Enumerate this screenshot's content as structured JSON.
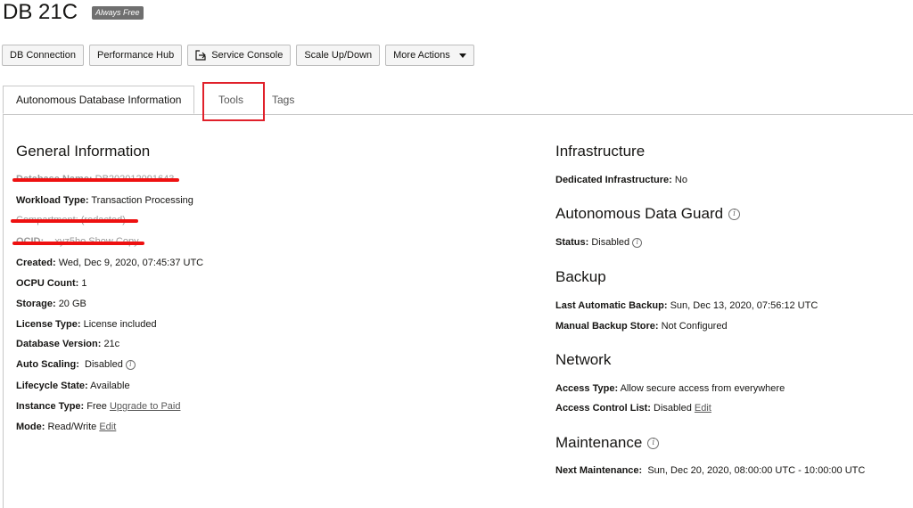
{
  "header": {
    "title": "DB 21C",
    "badge": "Always Free"
  },
  "toolbar": {
    "db_connection": "DB Connection",
    "performance_hub": "Performance Hub",
    "service_console": "Service Console",
    "scale": "Scale Up/Down",
    "more_actions": "More Actions"
  },
  "tabs": {
    "info": "Autonomous Database Information",
    "tools": "Tools",
    "tags": "Tags"
  },
  "general": {
    "heading": "General Information",
    "db_name_label": "Database Name:",
    "db_name_value": "DB202012091643",
    "workload_label": "Workload Type:",
    "workload_value": "Transaction Processing",
    "compartment_text": "Compartment: (redacted)",
    "ocid_label": "OCID:",
    "ocid_value": "...xyz5ho Show Copy",
    "created_label": "Created:",
    "created_value": "Wed, Dec 9, 2020, 07:45:37 UTC",
    "ocpu_label": "OCPU Count:",
    "ocpu_value": "1",
    "storage_label": "Storage:",
    "storage_value": "20 GB",
    "license_label": "License Type:",
    "license_value": "License included",
    "version_label": "Database Version:",
    "version_value": "21c",
    "autoscale_label": "Auto Scaling:",
    "autoscale_value": "Disabled",
    "lifecycle_label": "Lifecycle State:",
    "lifecycle_value": "Available",
    "instance_label": "Instance Type:",
    "instance_value": "Free",
    "upgrade_link": "Upgrade to Paid",
    "mode_label": "Mode:",
    "mode_value": "Read/Write",
    "mode_edit": "Edit"
  },
  "infrastructure": {
    "heading": "Infrastructure",
    "dedicated_label": "Dedicated Infrastructure:",
    "dedicated_value": "No"
  },
  "data_guard": {
    "heading": "Autonomous Data Guard",
    "status_label": "Status:",
    "status_value": "Disabled"
  },
  "backup": {
    "heading": "Backup",
    "last_label": "Last Automatic Backup:",
    "last_value": "Sun, Dec 13, 2020, 07:56:12 UTC",
    "store_label": "Manual Backup Store:",
    "store_value": "Not Configured"
  },
  "network": {
    "heading": "Network",
    "access_label": "Access Type:",
    "access_value": "Allow secure access from everywhere",
    "acl_label": "Access Control List:",
    "acl_value": "Disabled",
    "acl_edit": "Edit"
  },
  "maintenance": {
    "heading": "Maintenance",
    "next_label": "Next Maintenance:",
    "next_value": "Sun, Dec 20, 2020, 08:00:00 UTC - 10:00:00 UTC"
  },
  "icons": {
    "info": "i",
    "highlight_color": "#e0202a"
  }
}
